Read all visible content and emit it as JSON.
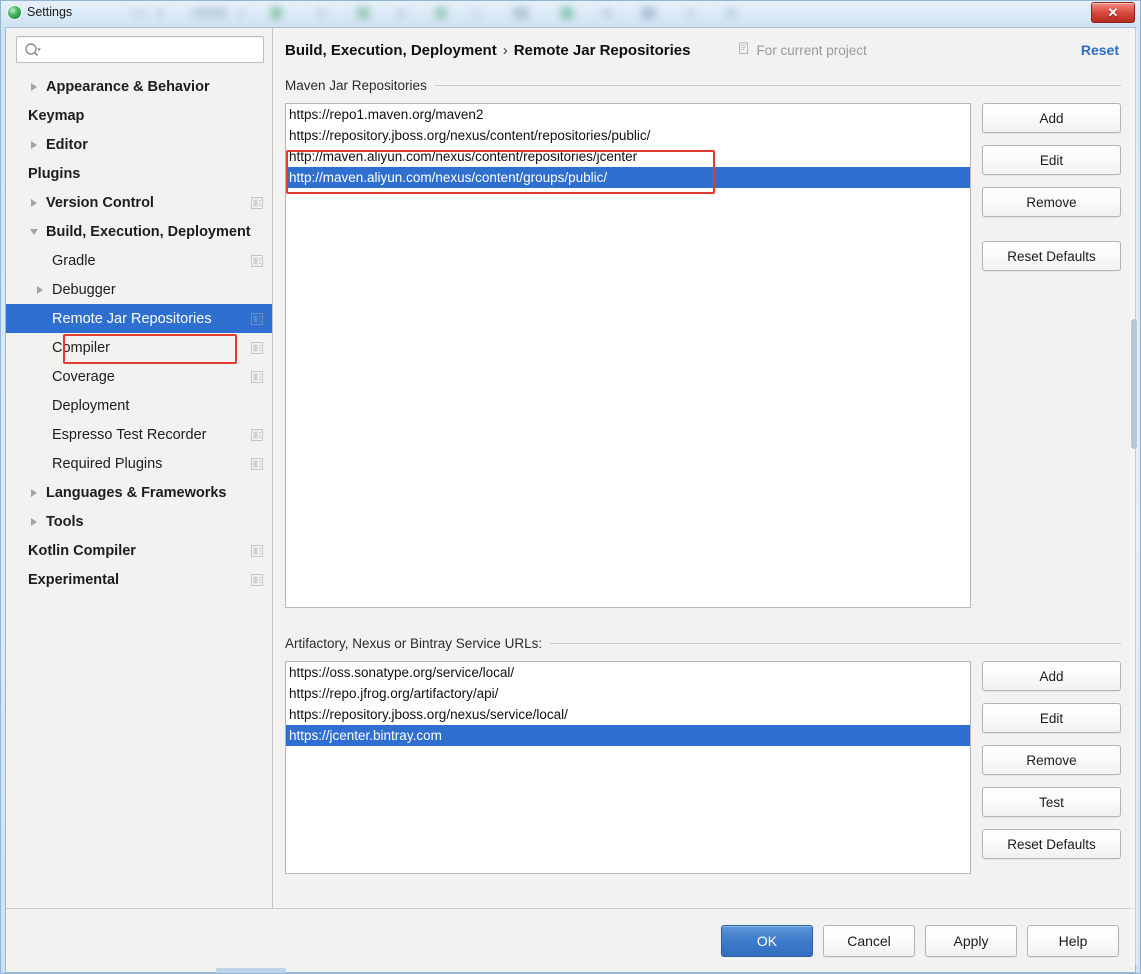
{
  "window": {
    "title": "Settings",
    "app_icon": "intellij-logo-icon",
    "close_label": "✕"
  },
  "sidebar": {
    "search": {
      "value": "",
      "placeholder": "",
      "icon": "search-icon"
    },
    "items": [
      {
        "label": "Appearance & Behavior",
        "depth": 0,
        "bold": true,
        "arrow": "collapsed",
        "config_icon": false,
        "selected": false
      },
      {
        "label": "Keymap",
        "depth": 0,
        "bold": true,
        "arrow": "none",
        "config_icon": false,
        "selected": false
      },
      {
        "label": "Editor",
        "depth": 0,
        "bold": true,
        "arrow": "collapsed",
        "config_icon": false,
        "selected": false
      },
      {
        "label": "Plugins",
        "depth": 0,
        "bold": true,
        "arrow": "none",
        "config_icon": false,
        "selected": false
      },
      {
        "label": "Version Control",
        "depth": 0,
        "bold": true,
        "arrow": "collapsed",
        "config_icon": true,
        "selected": false
      },
      {
        "label": "Build, Execution, Deployment",
        "depth": 0,
        "bold": true,
        "arrow": "expanded",
        "config_icon": false,
        "selected": false
      },
      {
        "label": "Gradle",
        "depth": 1,
        "bold": false,
        "arrow": "none",
        "config_icon": true,
        "selected": false
      },
      {
        "label": "Debugger",
        "depth": 1,
        "bold": false,
        "arrow": "collapsed",
        "config_icon": false,
        "selected": false
      },
      {
        "label": "Remote Jar Repositories",
        "depth": 1,
        "bold": false,
        "arrow": "none",
        "config_icon": true,
        "selected": true
      },
      {
        "label": "Compiler",
        "depth": 1,
        "bold": false,
        "arrow": "none",
        "config_icon": true,
        "selected": false
      },
      {
        "label": "Coverage",
        "depth": 1,
        "bold": false,
        "arrow": "none",
        "config_icon": true,
        "selected": false
      },
      {
        "label": "Deployment",
        "depth": 1,
        "bold": false,
        "arrow": "none",
        "config_icon": false,
        "selected": false
      },
      {
        "label": "Espresso Test Recorder",
        "depth": 1,
        "bold": false,
        "arrow": "none",
        "config_icon": true,
        "selected": false
      },
      {
        "label": "Required Plugins",
        "depth": 1,
        "bold": false,
        "arrow": "none",
        "config_icon": true,
        "selected": false
      },
      {
        "label": "Languages & Frameworks",
        "depth": 0,
        "bold": true,
        "arrow": "collapsed",
        "config_icon": false,
        "selected": false
      },
      {
        "label": "Tools",
        "depth": 0,
        "bold": true,
        "arrow": "collapsed",
        "config_icon": false,
        "selected": false
      },
      {
        "label": "Kotlin Compiler",
        "depth": 0,
        "bold": true,
        "arrow": "none",
        "config_icon": true,
        "selected": false
      },
      {
        "label": "Experimental",
        "depth": 0,
        "bold": true,
        "arrow": "none",
        "config_icon": true,
        "selected": false
      }
    ]
  },
  "header": {
    "breadcrumb_parent": "Build, Execution, Deployment",
    "breadcrumb_separator": "›",
    "breadcrumb_current": "Remote Jar Repositories",
    "for_current_project": "For current project",
    "for_current_project_icon": "project-scope-icon",
    "reset_label": "Reset",
    "reset_color": "#2b6ec4"
  },
  "maven_section": {
    "title": "Maven Jar Repositories",
    "items": [
      {
        "url": "https://repo1.maven.org/maven2",
        "selected": false
      },
      {
        "url": "https://repository.jboss.org/nexus/content/repositories/public/",
        "selected": false
      },
      {
        "url": "http://maven.aliyun.com/nexus/content/repositories/jcenter",
        "selected": false
      },
      {
        "url": "http://maven.aliyun.com/nexus/content/groups/public/",
        "selected": true
      }
    ],
    "buttons": [
      {
        "label": "Add"
      },
      {
        "label": "Edit"
      },
      {
        "label": "Remove"
      }
    ],
    "reset_defaults_label": "Reset Defaults"
  },
  "service_section": {
    "title": "Artifactory, Nexus or Bintray Service URLs:",
    "items": [
      {
        "url": "https://oss.sonatype.org/service/local/",
        "selected": false
      },
      {
        "url": "https://repo.jfrog.org/artifactory/api/",
        "selected": false
      },
      {
        "url": "https://repository.jboss.org/nexus/service/local/",
        "selected": false
      },
      {
        "url": "https://jcenter.bintray.com",
        "selected": true
      }
    ],
    "buttons": [
      {
        "label": "Add"
      },
      {
        "label": "Edit"
      },
      {
        "label": "Remove"
      },
      {
        "label": "Test"
      },
      {
        "label": "Reset Defaults"
      }
    ]
  },
  "footer": {
    "buttons": [
      {
        "label": "OK",
        "primary": true
      },
      {
        "label": "Cancel",
        "primary": false
      },
      {
        "label": "Apply",
        "primary": false
      },
      {
        "label": "Help",
        "primary": false
      }
    ]
  },
  "annotations": {
    "highlight_color": "#e23b30",
    "selection_color": "#2f6fd0"
  }
}
